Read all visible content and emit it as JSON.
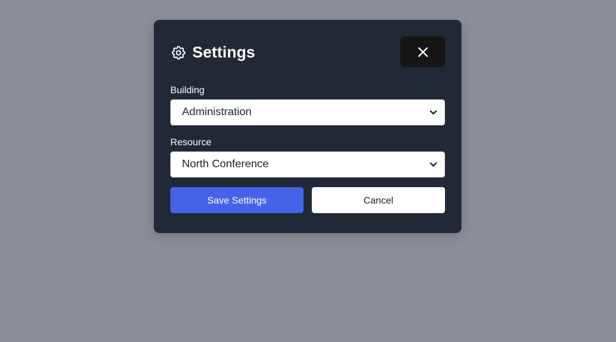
{
  "dialog": {
    "title": "Settings",
    "icon": "gear-icon",
    "close_icon": "close-icon"
  },
  "fields": {
    "building": {
      "label": "Building",
      "value": "Administration"
    },
    "resource": {
      "label": "Resource",
      "value": "North Conference"
    }
  },
  "actions": {
    "save_label": "Save Settings",
    "cancel_label": "Cancel"
  },
  "colors": {
    "backdrop": "#8b8e97",
    "modal_bg": "#212836",
    "primary": "#4563e6",
    "close_bg": "#161616"
  }
}
